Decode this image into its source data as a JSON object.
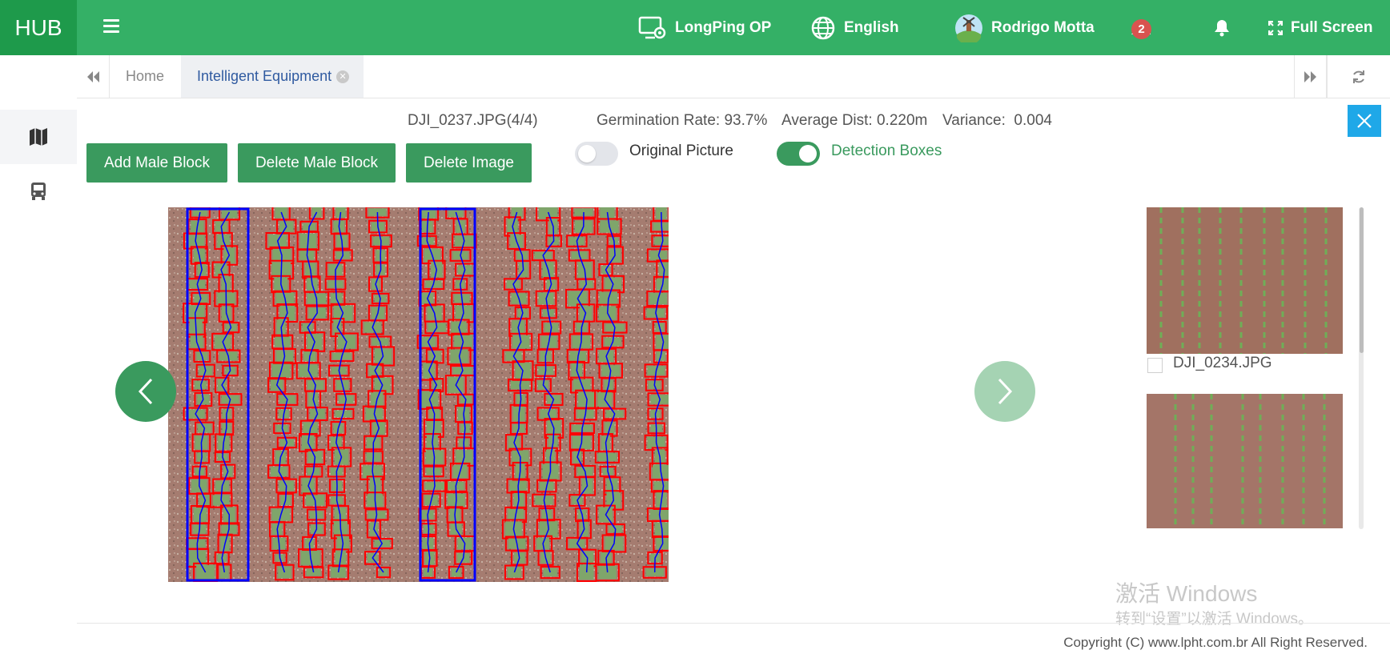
{
  "header": {
    "logo": "HUB",
    "org": "LongPing OP",
    "language": "English",
    "user_name": "Rodrigo Motta",
    "notification_count": "2",
    "fullscreen_label": "Full Screen"
  },
  "tabs": {
    "home": "Home",
    "active": "Intelligent Equipment"
  },
  "sidebar": {
    "icons": [
      "map-icon",
      "bus-icon"
    ]
  },
  "image_info": {
    "filename": "DJI_0237.JPG(4/4)",
    "germination": "Germination Rate: 93.7%",
    "avg_dist": "Average Dist: 0.220m",
    "variance": "Variance:  0.004"
  },
  "buttons": {
    "add_male": "Add Male Block",
    "delete_male": "Delete Male Block",
    "delete_image": "Delete Image"
  },
  "toggles": {
    "original_label": "Original Picture",
    "original_on": false,
    "detection_label": "Detection Boxes",
    "detection_on": true
  },
  "thumbnails": [
    {
      "label": "DJI_0234.JPG",
      "checked": false
    },
    {
      "label": "",
      "checked": false
    }
  ],
  "watermark": {
    "line1": "激活 Windows",
    "line2": "转到“设置”以激活 Windows。"
  },
  "footer": {
    "copyright": "Copyright (C) www.lpht.com.br All Right Reserved."
  },
  "colors": {
    "header_bg": "#34b066",
    "logo_bg": "#1e9a4b",
    "button_green": "#3a9a5e",
    "close_blue": "#1fa8e8",
    "detection_box": "#ff0000",
    "male_block": "#0000ff"
  }
}
